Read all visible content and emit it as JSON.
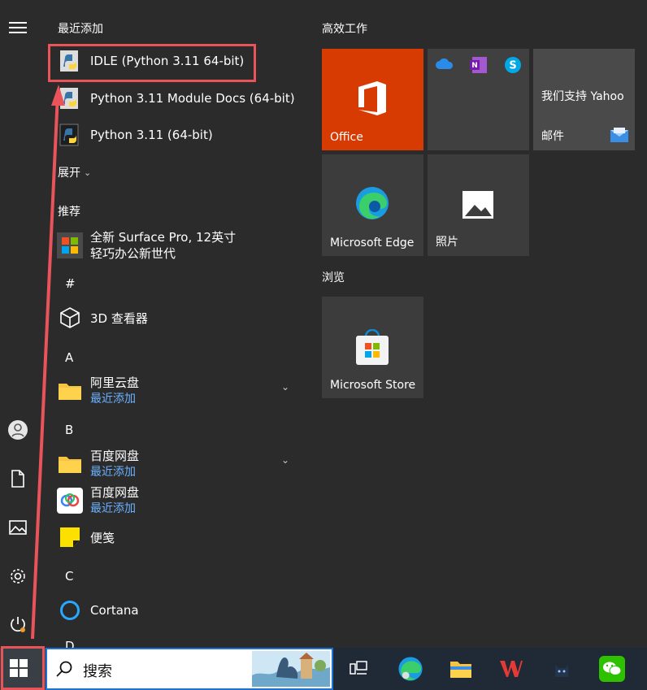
{
  "left_rail": {
    "menu": "menu-icon",
    "user": "user-icon",
    "documents": "document-icon",
    "pictures": "pictures-icon",
    "settings": "gear-icon",
    "power": "power-icon"
  },
  "app_list": {
    "recent_title": "最近添加",
    "recent": [
      {
        "label": "IDLE (Python 3.11 64-bit)",
        "icon": "python-icon"
      },
      {
        "label": "Python 3.11 Module Docs (64-bit)",
        "icon": "python-icon"
      },
      {
        "label": "Python 3.11 (64-bit)",
        "icon": "python-icon"
      }
    ],
    "expand_label": "展开",
    "recommended_title": "推荐",
    "recommended": {
      "line1": "全新 Surface Pro, 12英寸",
      "line2": "轻巧办公新世代"
    },
    "letters": [
      "#",
      "A",
      "B",
      "C",
      "D"
    ],
    "apps": [
      {
        "label": "3D 查看器"
      },
      {
        "label": "阿里云盘",
        "sub": "最近添加"
      },
      {
        "label": "百度网盘",
        "sub": "最近添加"
      },
      {
        "label": "百度网盘",
        "sub": "最近添加"
      },
      {
        "label": "便笺"
      },
      {
        "label": "Cortana"
      }
    ]
  },
  "tiles": {
    "group1_title": "高效工作",
    "group2_title": "浏览",
    "office": "Office",
    "yahoo_text": "我们支持 Yahoo",
    "mail": "邮件",
    "edge": "Microsoft Edge",
    "photos": "照片",
    "store": "Microsoft Store"
  },
  "taskbar": {
    "search_placeholder": "搜索"
  },
  "colors": {
    "office_orange": "#d83b01",
    "highlight_red": "#e8545a",
    "link_blue": "#6bb1ff"
  }
}
